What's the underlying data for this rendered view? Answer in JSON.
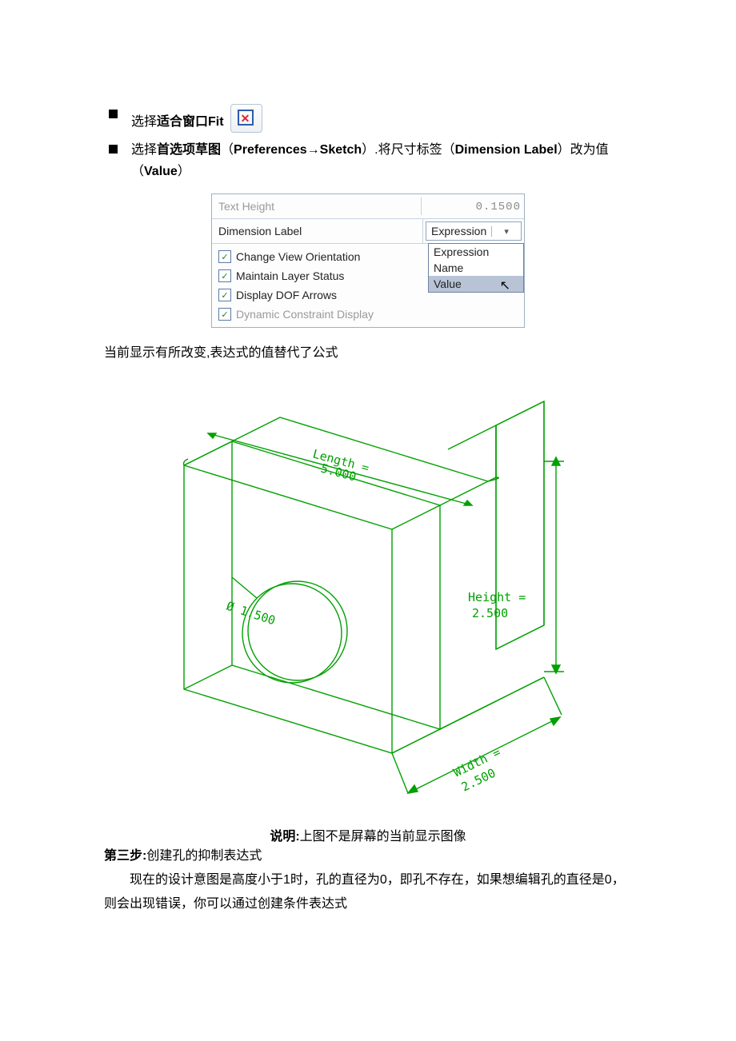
{
  "bullets": {
    "b1_prefix": "选择",
    "b1_bold": "适合窗口Fit",
    "b2_prefix": "选择",
    "b2_bold1": "首选项草图",
    "b2_paren_open": "（",
    "b2_pref": "Preferences",
    "b2_arrow": "→",
    "b2_sketch": "Sketch",
    "b2_paren_close": "）",
    "b2_mid": ".将尺寸标签（",
    "b2_dimlabel": "Dimension Label",
    "b2_mid2": "）改为值（",
    "b2_value": "Value",
    "b2_end": "）"
  },
  "prefs": {
    "row1_label": "Text Height",
    "row1_value": "0.1500",
    "row2_label": "Dimension Label",
    "row2_value": "Expression",
    "opt1": "Expression",
    "opt2": "Name",
    "opt3": "Value",
    "chk1": "Change View Orientation",
    "chk2": "Maintain Layer Status",
    "chk3": "Display DOF Arrows",
    "chk4": "Dynamic Constraint Display"
  },
  "caption1": "当前显示有所改变,表达式的值替代了公式",
  "diagram": {
    "length_lbl": "Length =",
    "length_val": "5.000",
    "height_lbl": "Height =",
    "height_val": "2.500",
    "width_lbl": "Width =",
    "width_val": "2.500",
    "dia_sym": "Ø",
    "dia_val": "1.500"
  },
  "note_bold": "说明:",
  "note_rest": "上图不是屏幕的当前显示图像",
  "step_bold": "第三步:",
  "step_rest": "创建孔的抑制表达式",
  "para1": "现在的设计意图是高度小于1时，孔的直径为0，即孔不存在，如果想编辑孔的直径是0，则会出现错误，你可以通过创建条件表达式"
}
